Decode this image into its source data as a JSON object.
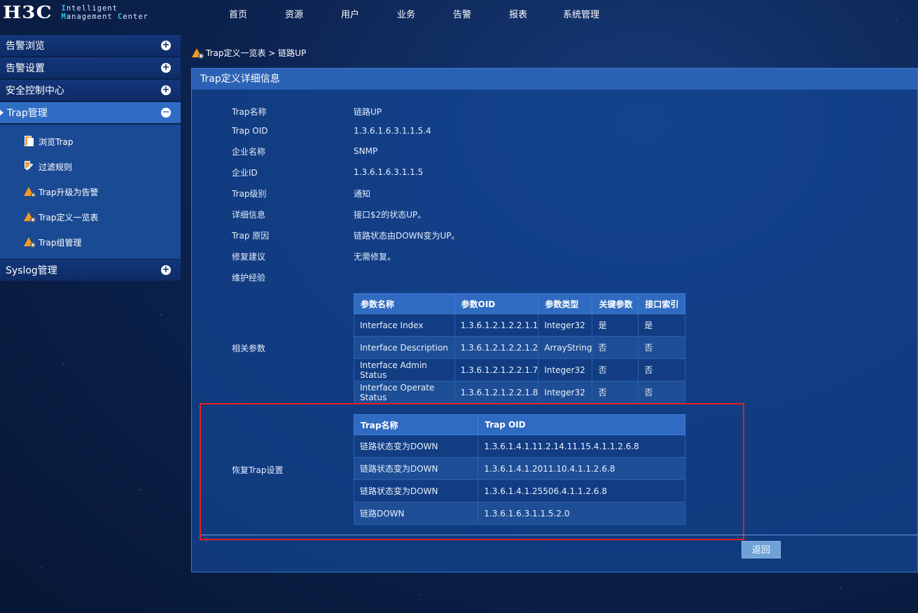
{
  "logo": {
    "mark": "H3C",
    "line1": [
      "I",
      "ntelligent"
    ],
    "line2": [
      "M",
      "anagement ",
      "C",
      "enter"
    ]
  },
  "topnav": [
    "首页",
    "资源",
    "用户",
    "业务",
    "告警",
    "报表",
    "系统管理"
  ],
  "sidebar": {
    "groups": [
      {
        "label": "告警浏览",
        "icon": "plus-icon"
      },
      {
        "label": "告警设置",
        "icon": "plus-icon"
      },
      {
        "label": "安全控制中心",
        "icon": "plus-icon"
      },
      {
        "label": "Trap管理",
        "icon": "minus-icon",
        "active": true
      },
      {
        "label": "Syslog管理",
        "icon": "plus-icon"
      }
    ],
    "sub_items": [
      {
        "label": "浏览Trap",
        "icon": "browse-trap-icon"
      },
      {
        "label": "过滤规则",
        "icon": "filter-rule-icon"
      },
      {
        "label": "Trap升级为告警",
        "icon": "trap-upgrade-icon"
      },
      {
        "label": "Trap定义一览表",
        "icon": "trap-definition-icon"
      },
      {
        "label": "Trap组管理",
        "icon": "trap-group-icon"
      }
    ]
  },
  "breadcrumb": {
    "text": "Trap定义一览表 > 链路UP",
    "icon": "warning-gear-icon"
  },
  "panel": {
    "title": "Trap定义详细信息",
    "fields": [
      {
        "label": "Trap名称",
        "value": "链路UP"
      },
      {
        "label": "Trap OID",
        "value": "1.3.6.1.6.3.1.1.5.4"
      },
      {
        "label": "企业名称",
        "value": "SNMP"
      },
      {
        "label": "企业ID",
        "value": "1.3.6.1.6.3.1.1.5"
      },
      {
        "label": "Trap级别",
        "value": "通知"
      },
      {
        "label": "详细信息",
        "value": "接口$2的状态UP。"
      },
      {
        "label": "Trap 原因",
        "value": "链路状态由DOWN变为UP。"
      },
      {
        "label": "修复建议",
        "value": "无需修复。"
      },
      {
        "label": "维护经验",
        "value": ""
      }
    ],
    "related_params_label": "相关参数",
    "params_table": {
      "headers": [
        "参数名称",
        "参数OID",
        "参数类型",
        "关键参数",
        "接口索引"
      ],
      "rows": [
        [
          "Interface Index",
          "1.3.6.1.2.1.2.2.1.1",
          "Integer32",
          "是",
          "是"
        ],
        [
          "Interface Description",
          "1.3.6.1.2.1.2.2.1.2",
          "ArrayString",
          "否",
          "否"
        ],
        [
          "Interface Admin Status",
          "1.3.6.1.2.1.2.2.1.7",
          "Integer32",
          "否",
          "否"
        ],
        [
          "Interface Operate Status",
          "1.3.6.1.2.1.2.2.1.8",
          "Integer32",
          "否",
          "否"
        ]
      ]
    },
    "recovery_label": "恢复Trap设置",
    "recovery_table": {
      "headers": [
        "Trap名称",
        "Trap OID"
      ],
      "rows": [
        [
          "链路状态变为DOWN",
          "1.3.6.1.4.1.11.2.14.11.15.4.1.1.2.6.8"
        ],
        [
          "链路状态变为DOWN",
          "1.3.6.1.4.1.2011.10.4.1.1.2.6.8"
        ],
        [
          "链路状态变为DOWN",
          "1.3.6.1.4.1.25506.4.1.1.2.6.8"
        ],
        [
          "链路DOWN",
          "1.3.6.1.6.3.1.1.5.2.0"
        ]
      ]
    },
    "return_label": "返回"
  },
  "colors": {
    "highlight_border": "#e3211f",
    "panel_title_bg": "#2c62b5",
    "active_menu_bg": "#2f6dc4",
    "warning_orange": "#f39a1d"
  }
}
